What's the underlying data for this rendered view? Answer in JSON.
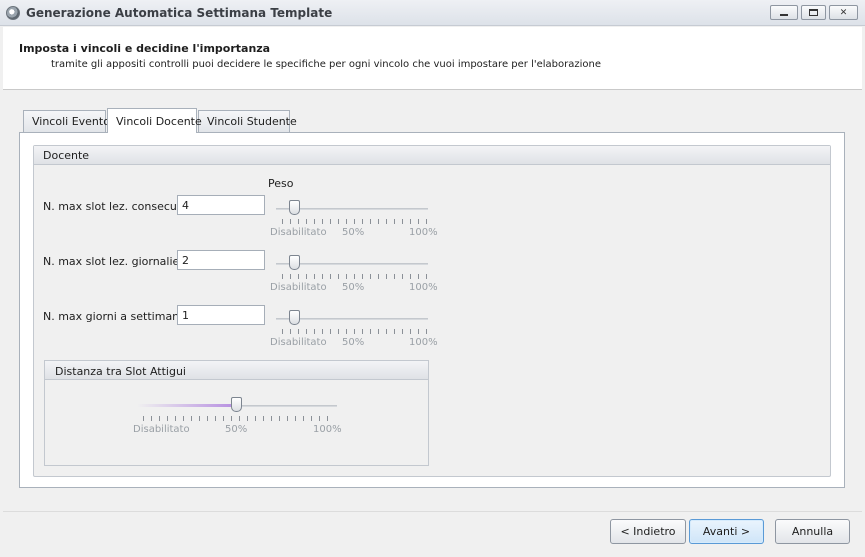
{
  "window": {
    "title": "Generazione Automatica Settimana Template",
    "icon": "app-gear-icon"
  },
  "header": {
    "title": "Imposta i vincoli e decidine l'importanza",
    "subtitle": "tramite gli appositi controlli puoi decidere le specifiche per ogni vincolo che vuoi impostare per l'elaborazione"
  },
  "tabs": [
    {
      "label": "Vincoli Evento",
      "active": false
    },
    {
      "label": "Vincoli Docente",
      "active": true
    },
    {
      "label": "Vincoli Studente",
      "active": false
    }
  ],
  "group": {
    "title": "Docente",
    "weight_header": "Peso",
    "constraints": [
      {
        "label": "N. max slot lez. consecutivi",
        "value": "4",
        "weight_pct": 0
      },
      {
        "label": "N. max slot lez. giornalieri",
        "value": "2",
        "weight_pct": 0
      },
      {
        "label": "N. max giorni a settimana",
        "value": "1",
        "weight_pct": 0
      }
    ],
    "slider_labels": {
      "min": "Disabilitato",
      "mid": "50%",
      "max": "100%"
    }
  },
  "subgroup": {
    "title": "Distanza tra Slot Attigui",
    "weight_pct": 50,
    "slider_labels": {
      "min": "Disabilitato",
      "mid": "50%",
      "max": "100%"
    }
  },
  "buttons": {
    "back": "< Indietro",
    "next": "Avanti >",
    "cancel": "Annulla"
  },
  "colors": {
    "accent": "#b48be0",
    "primary_button_border": "#5a9ad6"
  }
}
